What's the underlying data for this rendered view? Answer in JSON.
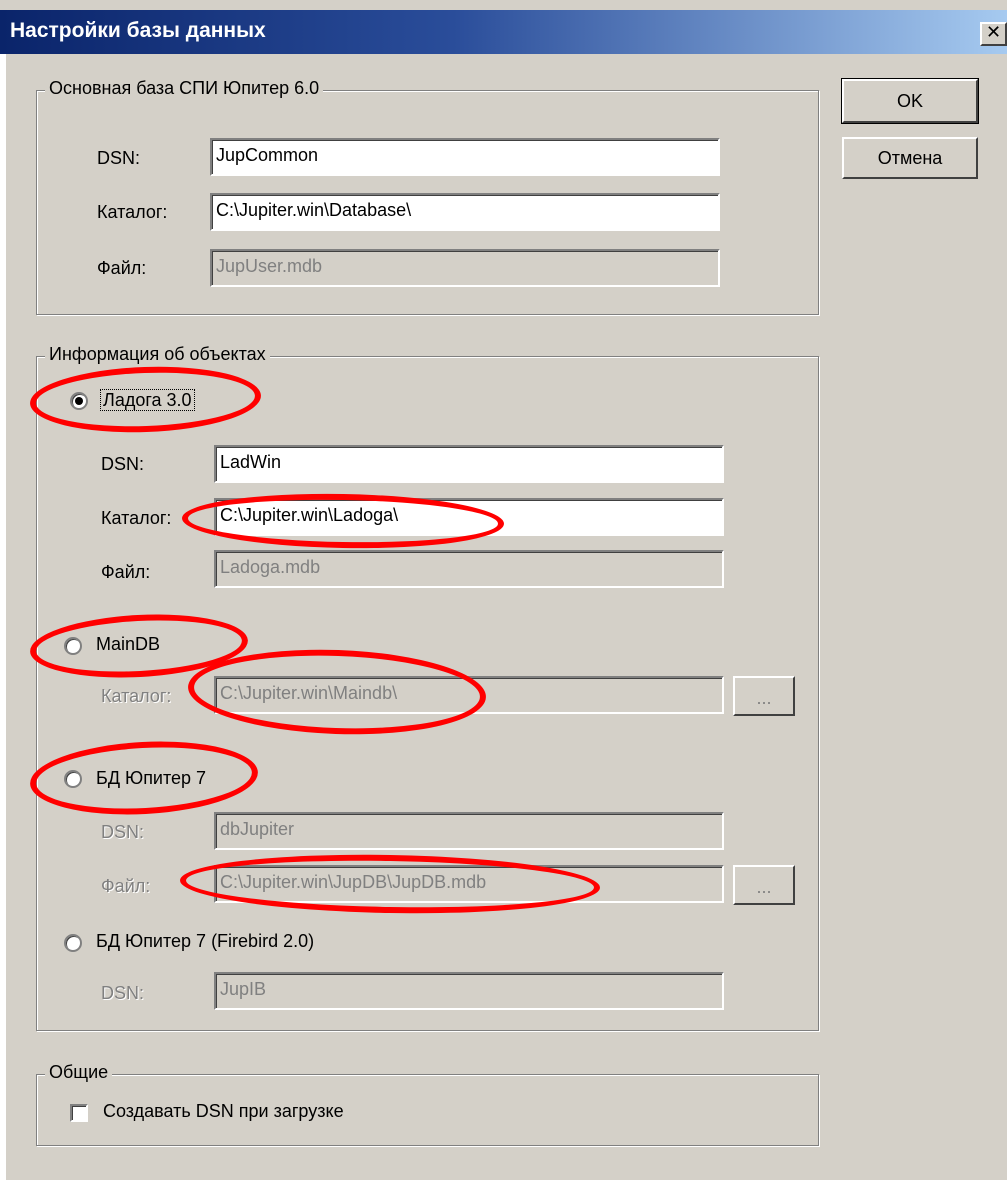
{
  "window": {
    "title": "Настройки базы данных",
    "close_glyph": "✕"
  },
  "buttons": {
    "ok": "OK",
    "cancel": "Отмена"
  },
  "main_db": {
    "group_label": "Основная база  СПИ Юпитер 6.0",
    "dsn_label": "DSN:",
    "dsn_value": "JupCommon",
    "catalog_label": "Каталог:",
    "catalog_value": "C:\\Jupiter.win\\Database\\",
    "file_label": "Файл:",
    "file_value": "JupUser.mdb"
  },
  "objects": {
    "group_label": "Информация об объектах",
    "ladoga": {
      "label": "Ладога 3.0",
      "selected": true,
      "dsn_label": "DSN:",
      "dsn_value": "LadWin",
      "catalog_label": "Каталог:",
      "catalog_value": "C:\\Jupiter.win\\Ladoga\\",
      "file_label": "Файл:",
      "file_value": "Ladoga.mdb"
    },
    "maindb": {
      "label": "MainDB",
      "catalog_label": "Каталог:",
      "catalog_value": "C:\\Jupiter.win\\Maindb\\",
      "browse_label": "..."
    },
    "jupiter7": {
      "label": "БД Юпитер 7",
      "dsn_label": "DSN:",
      "dsn_value": "dbJupiter",
      "file_label": "Файл:",
      "file_value": "C:\\Jupiter.win\\JupDB\\JupDB.mdb",
      "browse_label": "..."
    },
    "jupiter7_firebird": {
      "label": "БД Юпитер 7 (Firebird 2.0)",
      "dsn_label": "DSN:",
      "dsn_value": "JupIB"
    }
  },
  "general": {
    "group_label": "Общие",
    "create_dsn_label": "Создавать DSN при загрузке",
    "create_dsn_checked": false
  },
  "colors": {
    "annotation": "#ff0000",
    "dialog_bg": "#d4d0c8",
    "title_start": "#0a246a"
  }
}
